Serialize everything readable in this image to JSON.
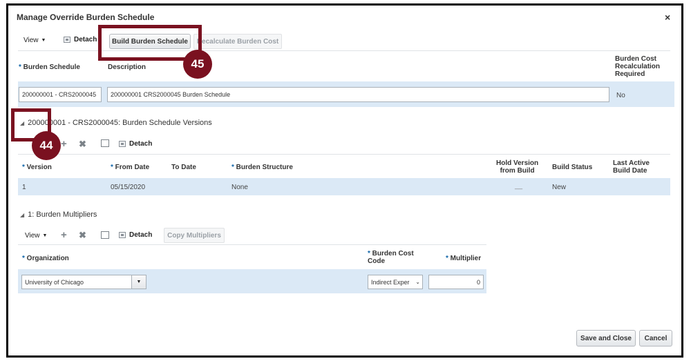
{
  "dialog": {
    "title": "Manage Override Burden Schedule",
    "close_glyph": "×"
  },
  "toolbar": {
    "view_label": "View",
    "detach_label": "Detach",
    "build_label": "Build Burden Schedule",
    "recalc_label": "Recalculate Burden Cost"
  },
  "schedule_table": {
    "headers": {
      "burden_schedule": "Burden Schedule",
      "description": "Description",
      "recalc": [
        "Burden Cost",
        "Recalculation",
        "Required"
      ]
    },
    "row": {
      "burden_schedule": "200000001 - CRS2000045",
      "description": "200000001 CRS2000045 Burden Schedule",
      "recalc": "No"
    }
  },
  "versions": {
    "section_title": "200000001 - CRS2000045: Burden Schedule Versions",
    "detach_label": "Detach",
    "headers": {
      "version": "Version",
      "from_date": "From Date",
      "to_date": "To Date",
      "structure": "Burden Structure",
      "hold": [
        "Hold Version",
        "from Build"
      ],
      "build_status": "Build Status",
      "last_active": [
        "Last Active",
        "Build Date"
      ]
    },
    "row": {
      "version": "1",
      "from_date": "05/15/2020",
      "to_date": "",
      "structure": "None",
      "hold": "__",
      "build_status": "New",
      "last_active": ""
    }
  },
  "multipliers": {
    "section_title": "1: Burden Multipliers",
    "view_label": "View",
    "detach_label": "Detach",
    "copy_label": "Copy Multipliers",
    "headers": {
      "organization": "Organization",
      "cost_code": [
        "Burden Cost",
        "Code"
      ],
      "multiplier": "Multiplier"
    },
    "row": {
      "organization": "University of Chicago",
      "cost_code": "Indirect Exper",
      "multiplier": "0"
    }
  },
  "footer": {
    "save_close_label": "Save and Close",
    "cancel_label": "Cancel"
  },
  "callouts": {
    "step_45": "45",
    "step_44": "44"
  },
  "colors": {
    "callout": "#7a1120",
    "selected_row": "#dbe9f6",
    "required_star": "#0e64a8"
  }
}
